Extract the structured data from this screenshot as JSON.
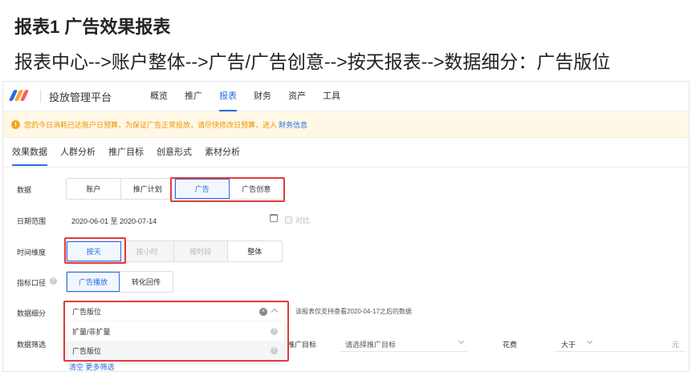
{
  "doc": {
    "title": "报表1  广告效果报表",
    "path": "报表中心-->账户整体-->广告/广告创意-->按天报表-->数据细分：广告版位"
  },
  "app": {
    "name": "投放管理平台",
    "logo_colors": [
      "#2a6be3",
      "#f5a623",
      "#ff5a5a"
    ],
    "nav": [
      {
        "label": "概览",
        "active": false
      },
      {
        "label": "推广",
        "active": false
      },
      {
        "label": "报表",
        "active": true
      },
      {
        "label": "财务",
        "active": false
      },
      {
        "label": "资产",
        "active": false
      },
      {
        "label": "工具",
        "active": false
      }
    ]
  },
  "notice": {
    "icon": "exclamation-icon",
    "text": "您的今日消耗已达账户日预算，为保证广告正常投放，请尽快修改日预算，进入",
    "link": "财务信息"
  },
  "subtabs": [
    {
      "label": "效果数据",
      "active": true
    },
    {
      "label": "人群分析",
      "active": false
    },
    {
      "label": "推广目标",
      "active": false
    },
    {
      "label": "创意形式",
      "active": false
    },
    {
      "label": "素材分析",
      "active": false
    }
  ],
  "form": {
    "data_label": "数据",
    "data_options": [
      "账户",
      "推广计划",
      "广告",
      "广告创意"
    ],
    "date_label": "日期范围",
    "date_value": "2020-06-01 至 2020-07-14",
    "compare_label": "对比",
    "time_label": "时间维度",
    "time_options": [
      "按天",
      "按小时",
      "按时段",
      "整体"
    ],
    "metric_label": "指标口径",
    "metric_options": [
      "广告播放",
      "转化回传"
    ],
    "breakdown_label": "数据细分",
    "breakdown_value": "广告版位",
    "breakdown_hint": "该报表仅支持查看2020-04-17之后的数据",
    "breakdown_options": [
      "扩量/非扩量",
      "广告版位"
    ],
    "filter_label": "数据筛选",
    "filter_target_label": "推广目标",
    "filter_target_placeholder": "请选择推广目标",
    "filter_cost_label": "花费",
    "filter_op": "大于",
    "filter_unit": "元",
    "bottom_links": "清空    更多筛选"
  },
  "colors": {
    "accent": "#2a6be3",
    "highlight_box": "#e23a3a",
    "warning": "#f29100"
  }
}
